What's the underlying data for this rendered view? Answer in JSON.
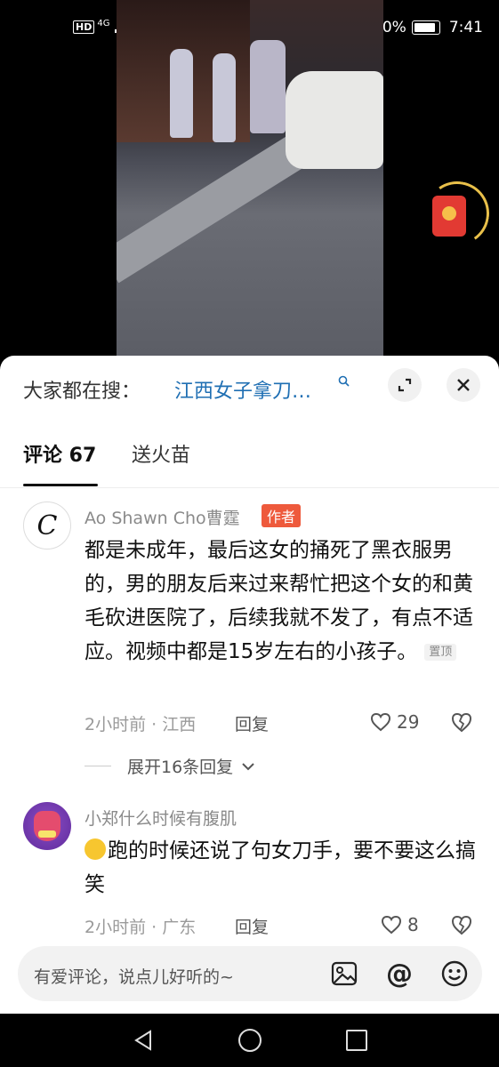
{
  "status_bar": {
    "network": "HD",
    "signal": "4G",
    "battery": "100%",
    "battery_level": 1.0,
    "time": "7:41",
    "icons": [
      "signal-icon",
      "wifi-icon",
      "weibo-icon",
      "video-app-icon",
      "search-app-icon",
      "taobao-icon",
      "alarm-icon",
      "bluetooth-icon",
      "battery-icon"
    ]
  },
  "video": {
    "red_packet_icon": "red-packet-icon"
  },
  "search_bar": {
    "prefix": "大家都在搜：",
    "term": "江西女子拿刀…",
    "icons": [
      "search-mini-icon",
      "expand-icon",
      "close-icon"
    ]
  },
  "tabs": [
    {
      "label": "评论 67",
      "active": true
    },
    {
      "label": "送火苗",
      "active": false
    }
  ],
  "comments": [
    {
      "username": "Ao Shawn Cho曹霆",
      "author_tag": "作者",
      "text": "都是未成年，最后这女的捅死了黑衣服男的，男的朋友后来过来帮忙把这个女的和黄毛砍进医院了，后续我就不发了，有点不适应。视频中都是15岁左右的小孩子。",
      "pinned_tag": "置顶",
      "meta": "2小时前 · 江西",
      "reply_label": "回复",
      "likes": "29",
      "expand_label": "展开16条回复"
    },
    {
      "username": "小郑什么时候有腹肌",
      "text": "跑的时候还说了句女刀手，要不要这么搞笑",
      "emoji": "laughing-crying-emoji",
      "meta": "2小时前 · 广东",
      "reply_label": "回复",
      "likes": "8"
    }
  ],
  "input_bar": {
    "placeholder": "有爱评论，说点儿好听的~",
    "icons": [
      "image-icon",
      "at-icon",
      "emoji-icon"
    ]
  },
  "nav_bar": {
    "icons": [
      "back-icon",
      "home-icon",
      "recent-apps-icon"
    ]
  },
  "colors": {
    "link_blue": "#1f6fb3",
    "author_tag": "#ee5a3c",
    "red_packet": "#e23a33"
  }
}
